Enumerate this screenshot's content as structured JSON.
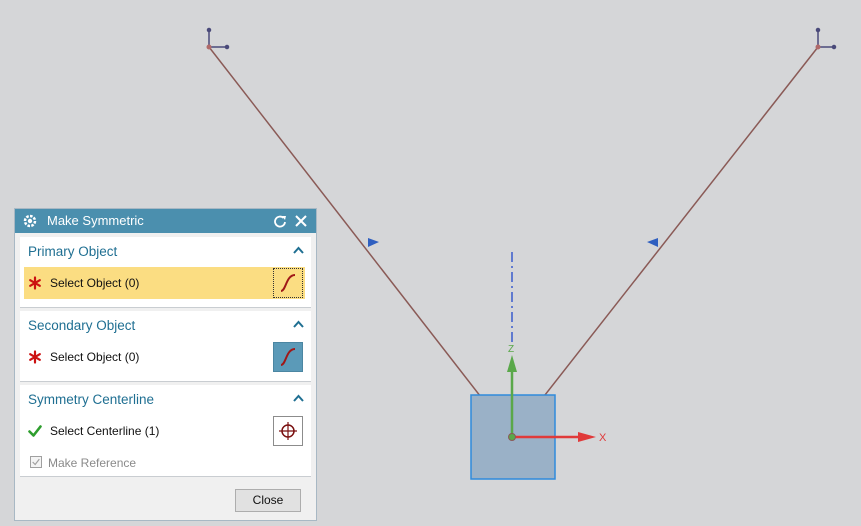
{
  "dialog": {
    "title": "Make Symmetric",
    "groups": {
      "primary": {
        "title": "Primary Object",
        "row_label": "Select Object (0)"
      },
      "secondary": {
        "title": "Secondary Object",
        "row_label": "Select Object (0)"
      },
      "centerline": {
        "title": "Symmetry Centerline",
        "row_label": "Select Centerline (1)",
        "make_reference_label": "Make Reference",
        "make_reference_checked": true
      }
    },
    "close_label": "Close"
  },
  "viewport": {
    "axis_x_label": "X",
    "colors": {
      "background": "#d5d6d8",
      "sketch_line": "#8a5a56",
      "handle": "#4a4a7a",
      "direction_arrow": "#2f5fc0",
      "centerline": "#3a5ccc",
      "x_axis": "#e03a3a",
      "z_axis": "#5aa84a",
      "csys_box": "#9ab1c7",
      "csys_box_border": "#2f8bdc"
    }
  },
  "icons": {
    "gear": "gear-icon",
    "reset": "reset-icon",
    "close": "close-icon",
    "collapse": "chevron-up-icon",
    "required": "asterisk-icon",
    "done": "checkmark-icon",
    "curve": "curve-icon",
    "point": "crosshair-icon"
  }
}
